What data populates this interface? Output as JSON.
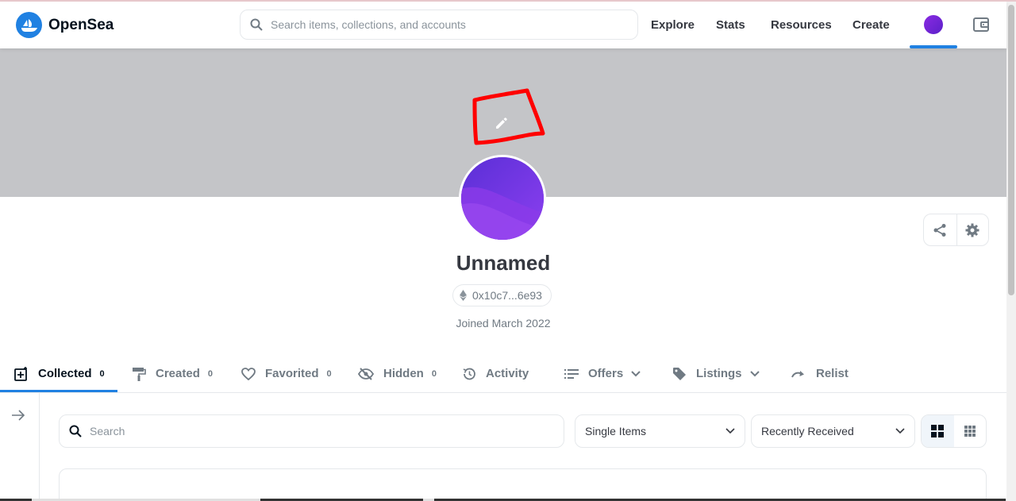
{
  "app": {
    "name": "OpenSea",
    "accent": "#2081e2"
  },
  "header": {
    "search_placeholder": "Search items, collections, and accounts",
    "nav": [
      "Explore",
      "Stats",
      "Resources",
      "Create"
    ]
  },
  "profile": {
    "name": "Unnamed",
    "address": "0x10c7...6e93",
    "joined": "Joined March 2022"
  },
  "tabs": [
    {
      "label": "Collected",
      "count": "0",
      "icon": "collected-icon"
    },
    {
      "label": "Created",
      "count": "0",
      "icon": "paint-roller-icon"
    },
    {
      "label": "Favorited",
      "count": "0",
      "icon": "heart-icon"
    },
    {
      "label": "Hidden",
      "count": "0",
      "icon": "eye-off-icon"
    },
    {
      "label": "Activity",
      "icon": "history-icon"
    },
    {
      "label": "Offers",
      "icon": "list-icon"
    },
    {
      "label": "Listings",
      "icon": "tag-icon"
    },
    {
      "label": "Relist",
      "icon": "redo-icon"
    }
  ],
  "filters": {
    "search_placeholder": "Search",
    "item_type": "Single Items",
    "sort": "Recently Received"
  }
}
